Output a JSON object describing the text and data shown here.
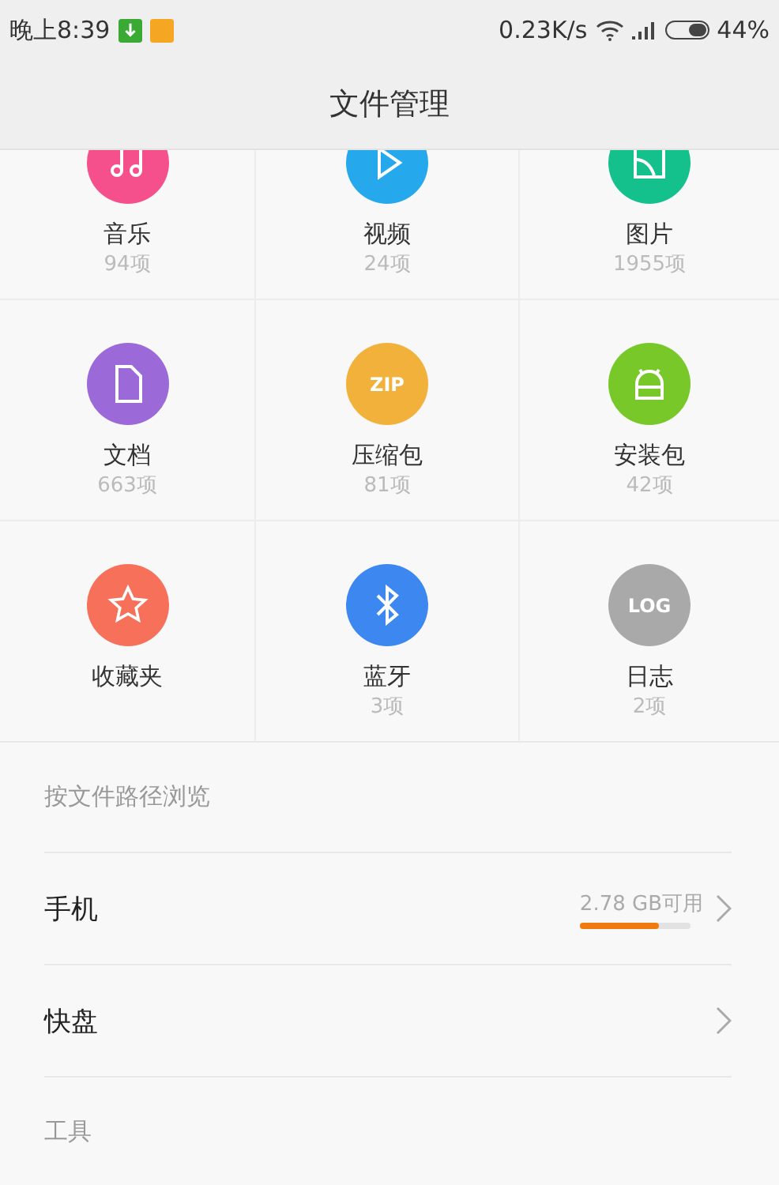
{
  "status_bar": {
    "time": "晚上8:39",
    "speed": "0.23K/s",
    "battery": "44%"
  },
  "header": {
    "title": "文件管理"
  },
  "categories": [
    {
      "kind": "music",
      "label": "音乐",
      "count": "94项",
      "color": "#f5508c"
    },
    {
      "kind": "video",
      "label": "视频",
      "count": "24项",
      "color": "#25a9ec"
    },
    {
      "kind": "image",
      "label": "图片",
      "count": "1955项",
      "color": "#14c08c"
    },
    {
      "kind": "document",
      "label": "文档",
      "count": "663项",
      "color": "#9b6ad8"
    },
    {
      "kind": "badge",
      "badge": "ZIP",
      "label": "压缩包",
      "count": "81项",
      "color": "#f2b13b"
    },
    {
      "kind": "android",
      "label": "安装包",
      "count": "42项",
      "color": "#78c82a"
    },
    {
      "kind": "star",
      "label": "收藏夹",
      "color": "#f7705a"
    },
    {
      "kind": "bluetooth",
      "label": "蓝牙",
      "count": "3项",
      "color": "#3d88f0"
    },
    {
      "kind": "badge",
      "badge": "LOG",
      "label": "日志",
      "count": "2项",
      "color": "#a9a9a9"
    }
  ],
  "browse": {
    "heading": "按文件路径浏览",
    "items": [
      {
        "label": "手机",
        "free": "2.78 GB可用",
        "level": 0.71
      },
      {
        "label": "快盘"
      }
    ]
  },
  "tools": {
    "heading": "工具"
  }
}
